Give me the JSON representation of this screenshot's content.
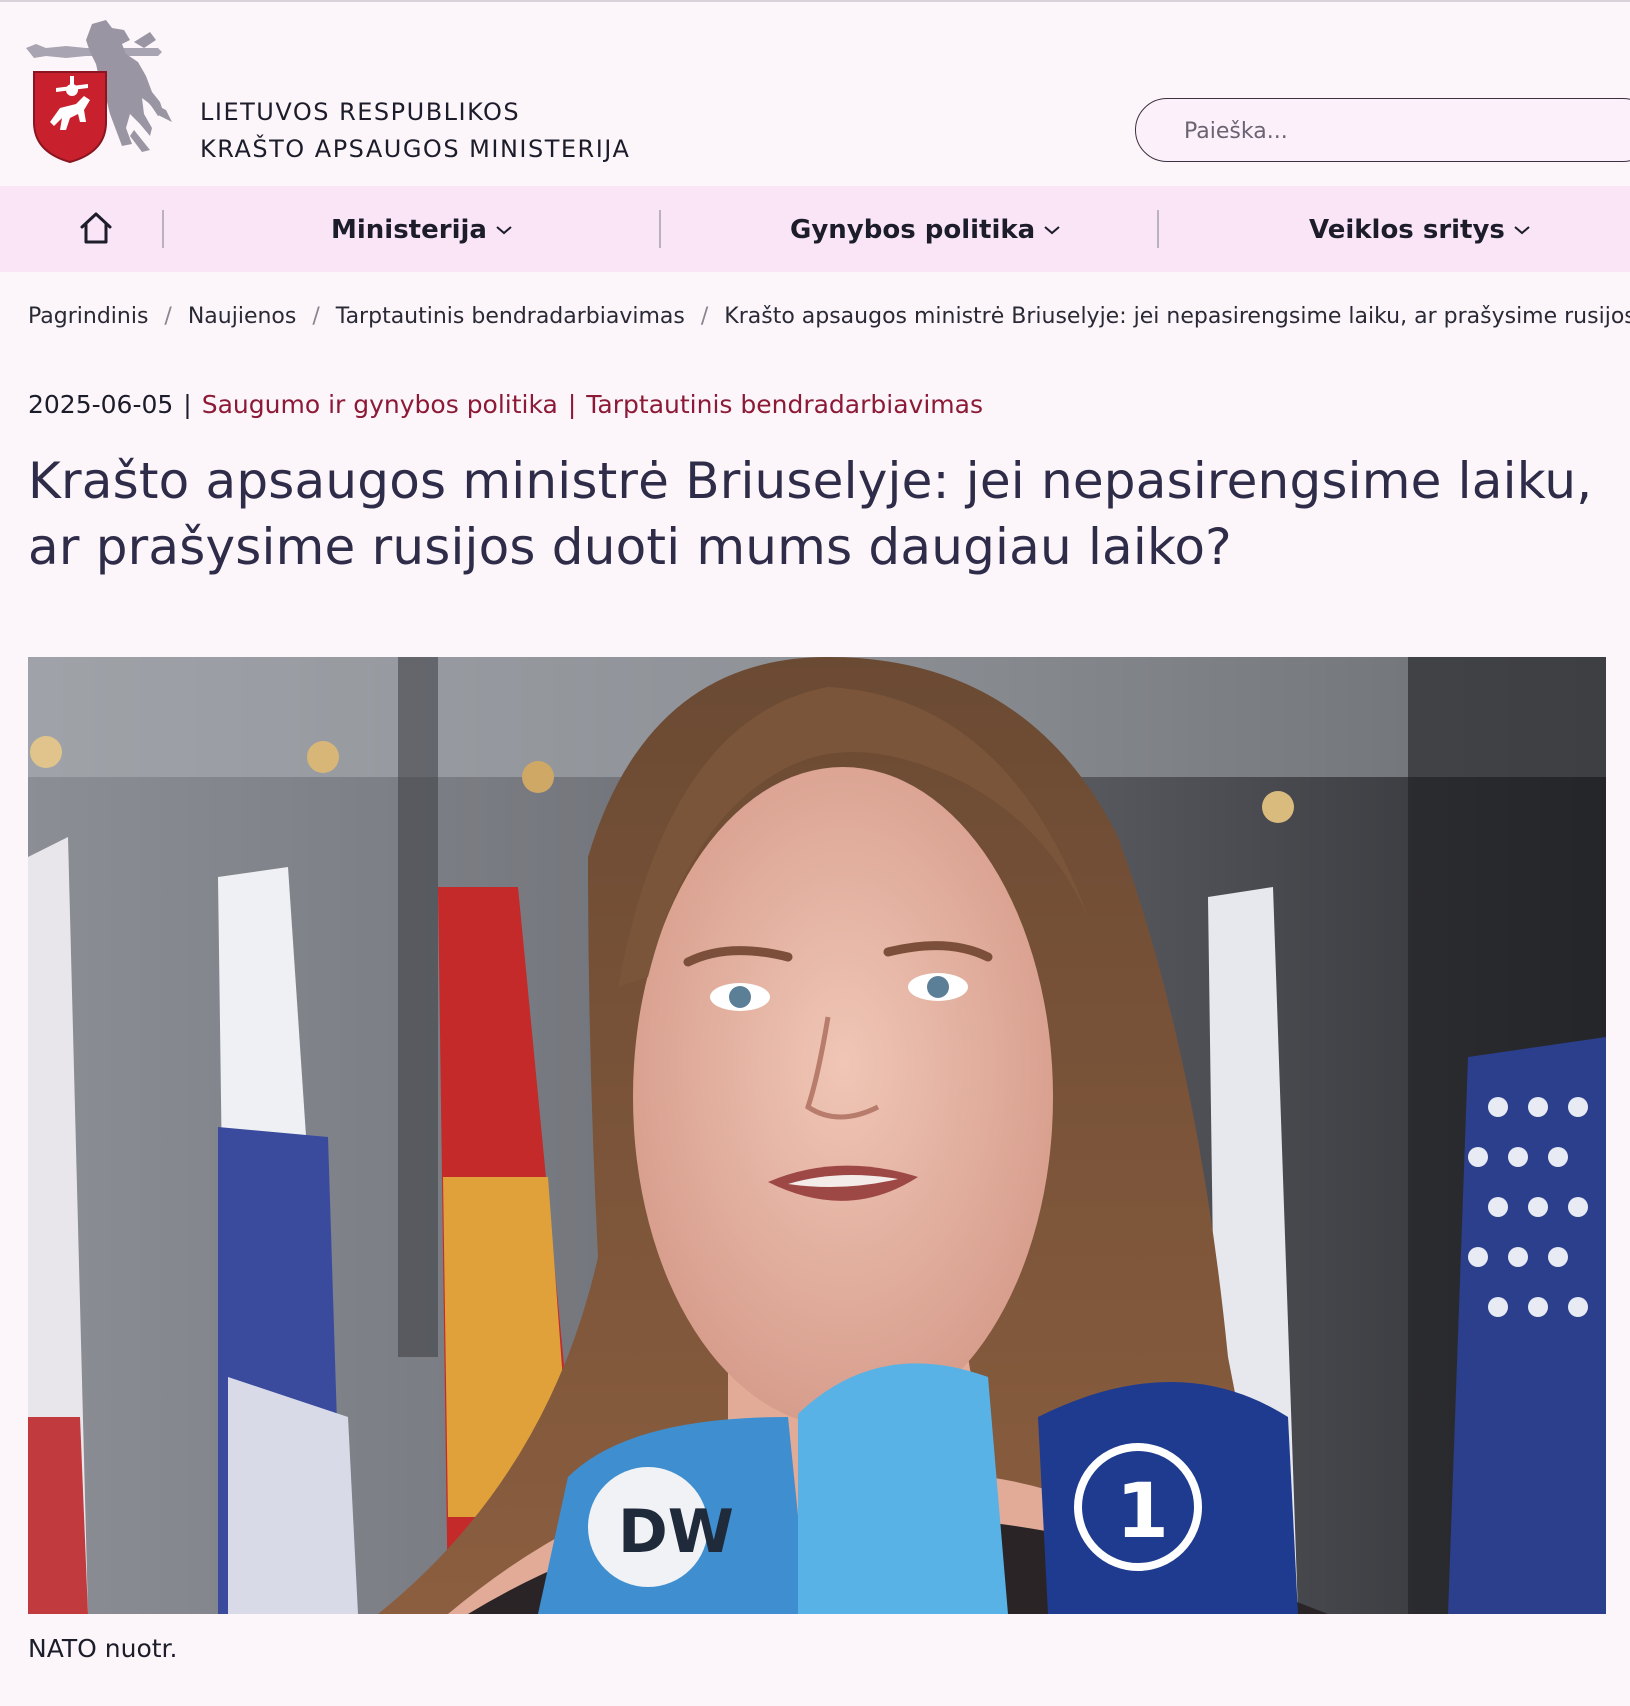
{
  "header": {
    "title_line1": "LIETUVOS RESPUBLIKOS",
    "title_line2": "KRAŠTO APSAUGOS MINISTERIJA",
    "search_placeholder": "Paieška..."
  },
  "nav": {
    "items": [
      {
        "label": "Ministerija"
      },
      {
        "label": "Gynybos politika"
      },
      {
        "label": "Veiklos sritys"
      }
    ]
  },
  "breadcrumb": {
    "items": [
      "Pagrindinis",
      "Naujienos",
      "Tarptautinis bendradarbiavimas",
      "Krašto apsaugos ministrė Briuselyje: jei nepasirengsime laiku, ar prašysime rusijos duoti mums daugiau laiko?"
    ]
  },
  "article": {
    "date": "2025-06-05",
    "categories": [
      "Saugumo ir gynybos politika",
      "Tarptautinis bendradarbiavimas"
    ],
    "title": "Krašto apsaugos ministrė Briuselyje: jei nepasirengsime laiku, ar prašysime rusijos duoti mums daugiau laiko?",
    "photo_caption": "NATO nuotr."
  },
  "colors": {
    "background": "#fcf6fb",
    "nav_background": "#f9e5f6",
    "category_link": "#8c1a36",
    "headline": "#2e2c48"
  },
  "icons": {
    "home": "home-icon",
    "chevron": "chevron-down-icon",
    "logo": "coat-of-arms-icon"
  }
}
